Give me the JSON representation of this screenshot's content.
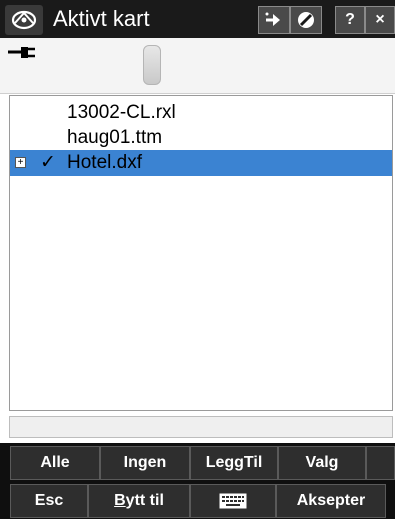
{
  "window": {
    "title": "Aktivt kart"
  },
  "titlebar_buttons": {
    "help_label": "?",
    "close_label": "×"
  },
  "list": {
    "items": [
      {
        "label": "13002-CL.rxl",
        "checked": false,
        "expandable": false,
        "selected": false
      },
      {
        "label": "haug01.ttm",
        "checked": false,
        "expandable": false,
        "selected": false
      },
      {
        "label": "Hotel.dxf",
        "checked": true,
        "expandable": true,
        "selected": true
      }
    ],
    "check_glyph": "✓",
    "expand_glyph": "+"
  },
  "softkeys_row1": {
    "all": "Alle",
    "none": "Ingen",
    "add": "LeggTil",
    "options": "Valg"
  },
  "softkeys_row2": {
    "esc": "Esc",
    "switch_prefix": "B",
    "switch_rest": "ytt til",
    "accept": "Aksepter"
  },
  "colors": {
    "titlebar": "#1a1a1a",
    "selection": "#3b83d2",
    "softkey_bg": "#2e2e2e"
  }
}
